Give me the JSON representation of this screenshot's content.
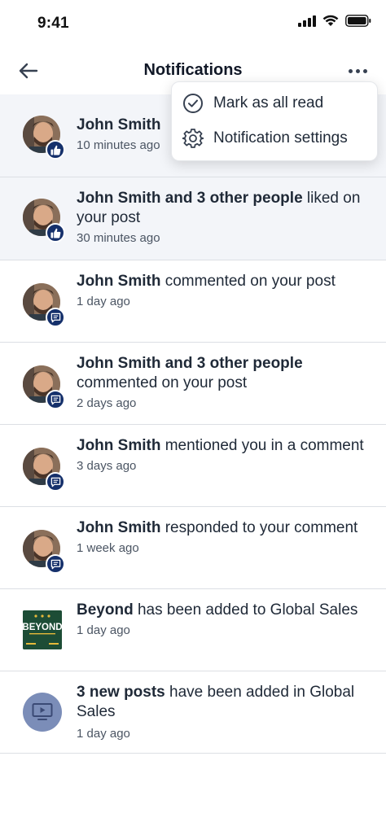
{
  "status_bar": {
    "time": "9:41"
  },
  "header": {
    "title": "Notifications"
  },
  "menu": {
    "items": [
      {
        "label": "Mark as all read",
        "icon": "check-circle-icon"
      },
      {
        "label": "Notification settings",
        "icon": "gear-icon"
      }
    ]
  },
  "notifications": [
    {
      "actor": "John Smith",
      "action": "",
      "time": "10 minutes ago",
      "type": "like",
      "unread": true
    },
    {
      "actor": "John Smith and 3 other people",
      "action": " liked on your post",
      "time": "30 minutes ago",
      "type": "like",
      "unread": true
    },
    {
      "actor": "John Smith",
      "action": " commented on your post",
      "time": "1 day ago",
      "type": "comment",
      "unread": false
    },
    {
      "actor": "John Smith and 3 other people",
      "action": " commented on your post",
      "time": "2 days ago",
      "type": "comment",
      "unread": false
    },
    {
      "actor": "John Smith",
      "action": " mentioned you in a comment",
      "time": "3 days ago",
      "type": "comment",
      "unread": false
    },
    {
      "actor": "John Smith",
      "action": " responded to your comment",
      "time": "1 week ago",
      "type": "comment",
      "unread": false
    },
    {
      "actor": "Beyond",
      "action": " has been added to Global Sales",
      "time": "1 day ago",
      "type": "program",
      "logo_text": "BEYOND",
      "unread": false
    },
    {
      "actor": "3 new posts",
      "action": " have been added in Global Sales",
      "time": "1 day ago",
      "type": "video",
      "unread": false
    }
  ],
  "colors": {
    "badge": "#15306b",
    "unread_bg": "#f3f5f9",
    "logo_bg": "#1d4d36",
    "video_bg": "#7b8db8"
  }
}
